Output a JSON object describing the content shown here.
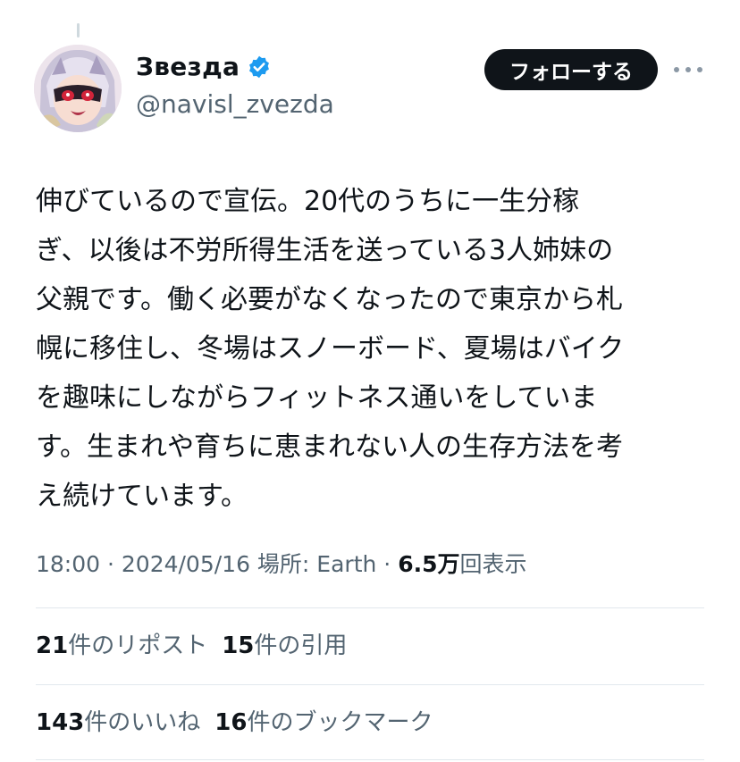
{
  "author": {
    "display_name": "Звезда",
    "handle": "@navisl_zvezda",
    "verified_icon": "verified-badge-icon",
    "verified_color": "#1d9bf0"
  },
  "actions": {
    "follow_label": "フォローする",
    "more_icon": "more-horizontal-icon"
  },
  "tweet": {
    "lines": [
      "伸びているので宣伝。20代のうちに一生分稼",
      "ぎ、以後は不労所得生活を送っている3人姉妹の",
      "父親です。働く必要がなくなったので東京から札",
      "幌に移住し、冬場はスノーボード、夏場はバイク",
      "を趣味にしながらフィットネス通いをしていま",
      "す。生まれや育ちに恵まれない人の生存方法を考",
      "え続けています。"
    ]
  },
  "meta": {
    "time": "18:00",
    "sep1": " · ",
    "date": "2024/05/16",
    "location": " 場所: Earth",
    "sep2": " · ",
    "views_count": "6.5万",
    "views_label": "回表示"
  },
  "stats": {
    "reposts_count": "21",
    "reposts_label": "件のリポスト",
    "quotes_count": "15",
    "quotes_label": "件の引用",
    "likes_count": "143",
    "likes_label": "件のいいね",
    "bookmarks_count": "16",
    "bookmarks_label": "件のブックマーク"
  },
  "colors": {
    "text_primary": "#0f1419",
    "text_secondary": "#536471",
    "follow_bg": "#0f1419"
  }
}
